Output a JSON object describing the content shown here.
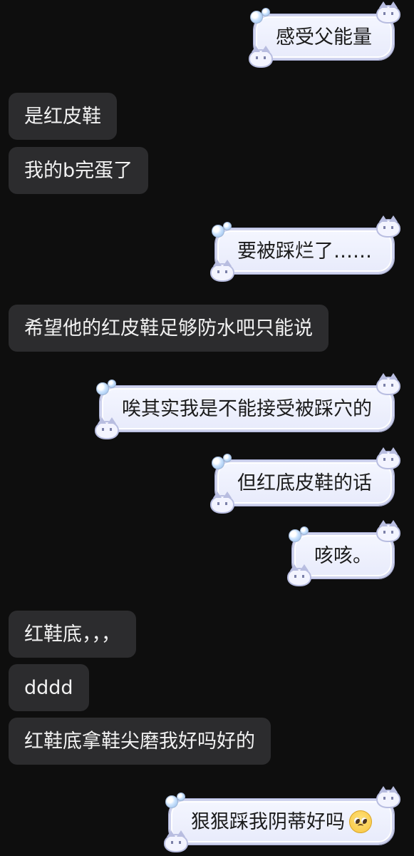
{
  "messages": [
    {
      "dir": "out",
      "text": "感受父能量"
    },
    {
      "dir": "in",
      "text": "是红皮鞋"
    },
    {
      "dir": "in",
      "text": "我的b完蛋了"
    },
    {
      "dir": "out",
      "text": "要被踩烂了……"
    },
    {
      "dir": "in",
      "text": "希望他的红皮鞋足够防水吧只能说"
    },
    {
      "dir": "out",
      "text": "唉其实我是不能接受被踩穴的"
    },
    {
      "dir": "out",
      "text": "但红底皮鞋的话"
    },
    {
      "dir": "out",
      "text": "咳咳。"
    },
    {
      "dir": "in",
      "text": "红鞋底，，，"
    },
    {
      "dir": "in",
      "text": "dddd"
    },
    {
      "dir": "in",
      "text": "红鞋底拿鞋尖磨我好吗好的"
    },
    {
      "dir": "out",
      "text": "狠狠踩我阴蒂好吗",
      "emoji": "pleading-face-emoji"
    }
  ],
  "colors": {
    "background": "#0e0e0e",
    "incoming_bubble": "#2c2c2e",
    "incoming_text": "#f2f2f2",
    "outgoing_bubble": "#eef0fd",
    "outgoing_text": "#1b1b1b"
  }
}
